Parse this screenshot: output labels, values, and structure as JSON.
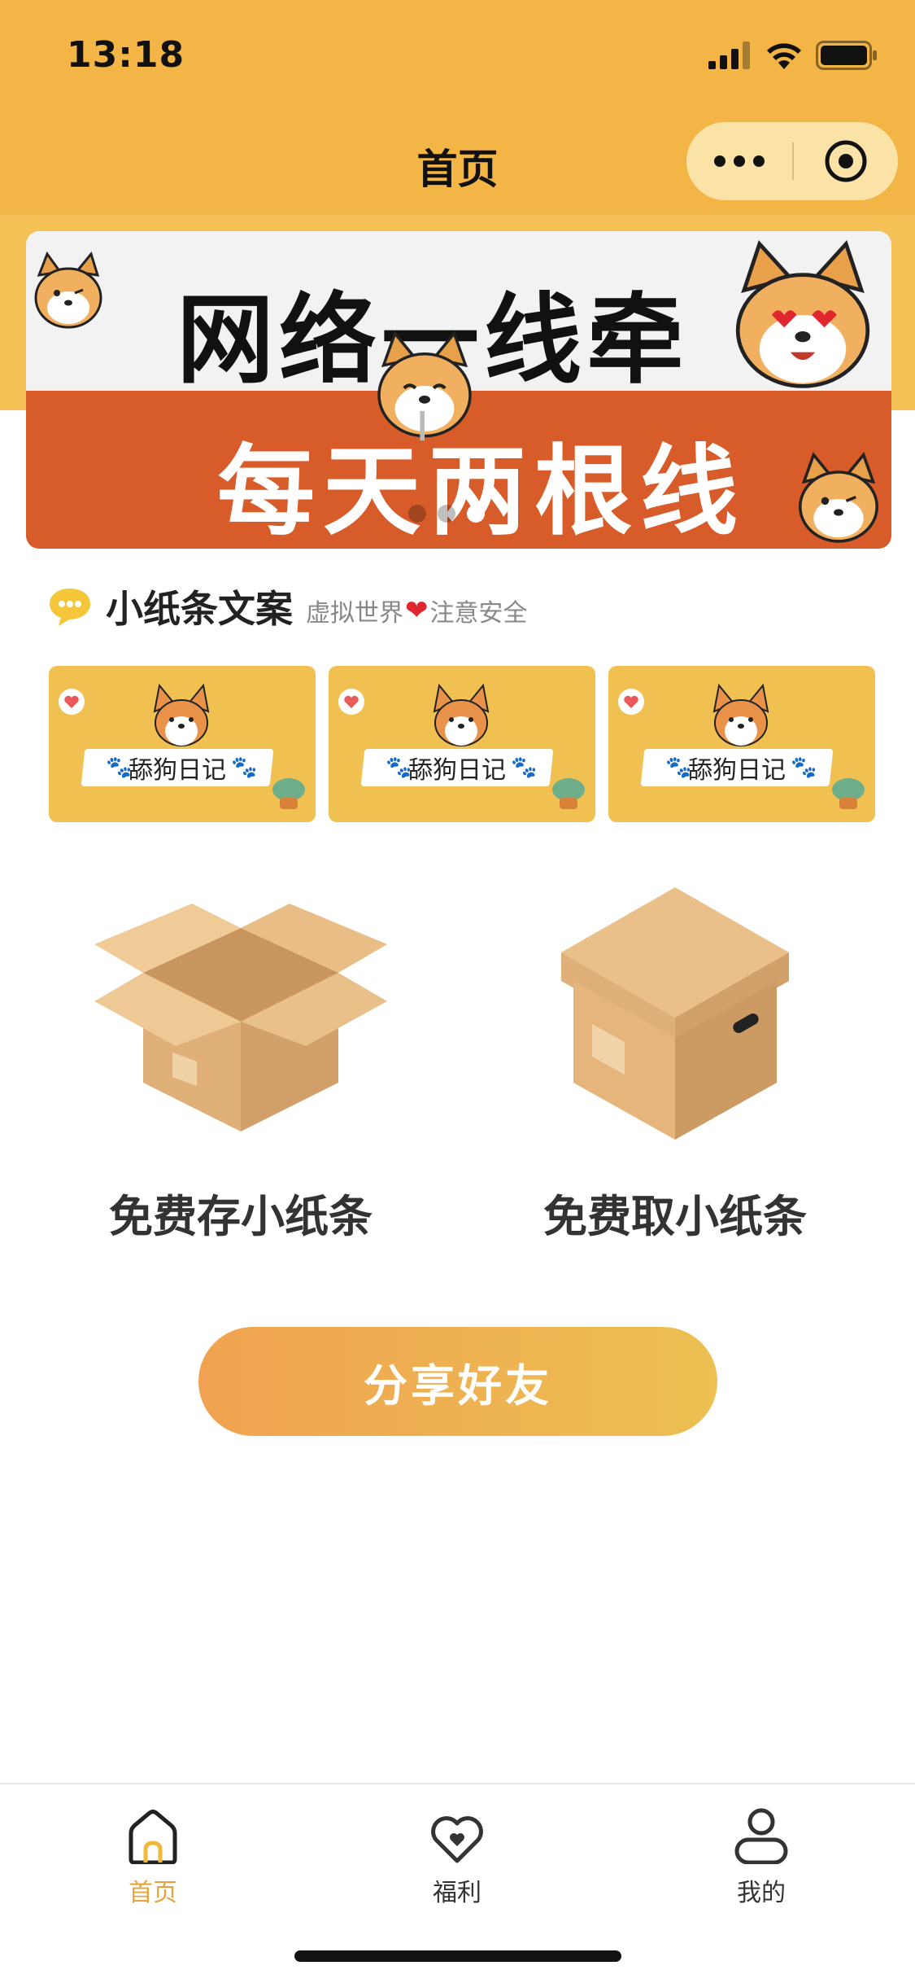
{
  "status_bar": {
    "time": "13:18"
  },
  "nav": {
    "title": "首页"
  },
  "banner": {
    "line1": "网络一线牵",
    "line2": "每天两根线",
    "dot_count": 3,
    "active_dot": 2
  },
  "section": {
    "title": "小纸条文案",
    "subtitle_before": "虚拟世界",
    "subtitle_after": "注意安全"
  },
  "cards": [
    {
      "label": "舔狗日记"
    },
    {
      "label": "舔狗日记"
    },
    {
      "label": "舔狗日记"
    }
  ],
  "actions": {
    "store_label": "免费存小纸条",
    "take_label": "免费取小纸条"
  },
  "share": {
    "label": "分享好友"
  },
  "tabbar": {
    "items": [
      {
        "label": "首页",
        "icon": "home-icon",
        "active": true
      },
      {
        "label": "福利",
        "icon": "heart-icon",
        "active": false
      },
      {
        "label": "我的",
        "icon": "user-icon",
        "active": false
      }
    ]
  },
  "colors": {
    "header": "#f3b545",
    "accent": "#e8a33c",
    "banner_red": "#d85b2a",
    "card": "#f0c150"
  }
}
